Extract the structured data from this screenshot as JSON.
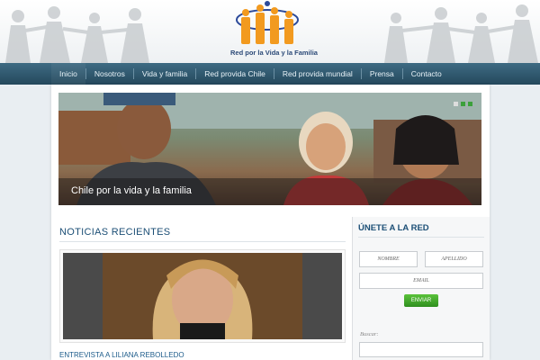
{
  "brand": {
    "logo_text": "Red por la Vida y la Familia"
  },
  "nav": {
    "items": [
      {
        "label": "Inicio"
      },
      {
        "label": "Nosotros"
      },
      {
        "label": "Vida y familia"
      },
      {
        "label": "Red provida Chile"
      },
      {
        "label": "Red provida mundial"
      },
      {
        "label": "Prensa"
      },
      {
        "label": "Contacto"
      }
    ]
  },
  "slider": {
    "caption": "Chile por la vida y la familia"
  },
  "news": {
    "title": "NOTICIAS RECIENTES",
    "item_caption": "ENTREVISTA A LILIANA REBOLLEDO"
  },
  "join": {
    "title": "ÚNETE A LA RED",
    "name_placeholder": "NOMBRE",
    "surname_placeholder": "APELLIDO",
    "email_placeholder": "EMAIL",
    "submit_label": "ENVIAR",
    "search_label": "Buscar:"
  },
  "colors": {
    "nav": "#2e5a70",
    "accent_green": "#3ca03c",
    "heading": "#1c4f76"
  }
}
